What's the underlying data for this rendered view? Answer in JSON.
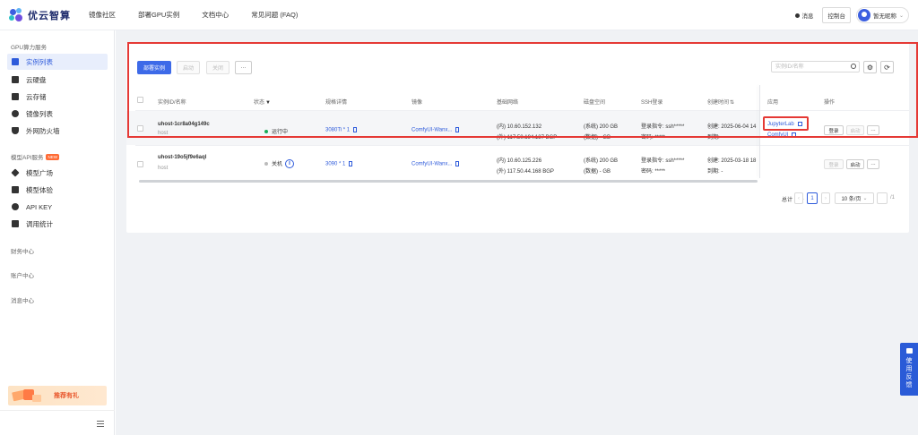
{
  "brand": {
    "name": "优云智算"
  },
  "topnav": [
    "镜像社区",
    "部署GPU实例",
    "文档中心",
    "常见问题 (FAQ)"
  ],
  "topright": {
    "message": "消息",
    "console": "控制台",
    "username": "暂无昵称"
  },
  "sidebar": {
    "section1": "GPU算力服务",
    "items1": [
      {
        "label": "实例列表",
        "icon": "server-list-icon",
        "active": true
      },
      {
        "label": "云硬盘",
        "icon": "disk-icon"
      },
      {
        "label": "云存储",
        "icon": "folder-icon"
      },
      {
        "label": "镜像列表",
        "icon": "image-icon"
      },
      {
        "label": "外网防火墙",
        "icon": "shield-icon"
      }
    ],
    "section2": "模型API服务",
    "section2_tag": "NEW",
    "items2": [
      {
        "label": "模型广场",
        "icon": "grid-icon"
      },
      {
        "label": "模型体验",
        "icon": "cube-icon"
      },
      {
        "label": "API KEY",
        "icon": "key-icon"
      },
      {
        "label": "调用统计",
        "icon": "chart-icon"
      }
    ],
    "section3": "财务中心",
    "section4": "账户中心",
    "section5": "消息中心",
    "promo": "推荐有礼"
  },
  "toolbar": {
    "deploy": "部署实例",
    "start": "启动",
    "shutdown": "关闭",
    "more": "···",
    "search_placeholder": "实例ID/名称"
  },
  "table": {
    "headers": [
      "实例ID/名称",
      "状态",
      "规格详情",
      "镜像",
      "基础网络",
      "磁盘空间",
      "SSH登录",
      "创建时间",
      "应用",
      "操作"
    ],
    "rows": [
      {
        "id": "uhost-1cr8a04g149c",
        "name": "host",
        "status": "运行中",
        "status_color": "#1aad5a",
        "spec": "3080Ti * 1",
        "image": "ComfyUI-Wanx...",
        "net_in": "(内) 10.60.152.132",
        "net_out": "(外) 117.50.194.137 BGP",
        "disk_sys": "(系统) 200 GB",
        "disk_data": "(数据) - GB",
        "ssh_cmd_label": "登录指令:",
        "ssh_cmd": "ssh*****",
        "ssh_pwd_label": "密码:",
        "ssh_pwd": "*****",
        "created": "创建: 2025-06-04 14",
        "expire": "到期: -",
        "apps": [
          "JupyterLab",
          "ComfyUI"
        ],
        "actions": [
          "登录",
          "启动",
          "···"
        ]
      },
      {
        "id": "uhost-19o5jf9e6aql",
        "name": "host",
        "status": "关机",
        "status_color": "#bbbbbb",
        "spec": "3090 * 1",
        "image": "ComfyUI-Wanx...",
        "net_in": "(内) 10.60.125.226",
        "net_out": "(外) 117.50.44.168 BGP",
        "disk_sys": "(系统) 200 GB",
        "disk_data": "(数据) - GB",
        "ssh_cmd_label": "登录指令:",
        "ssh_cmd": "ssh*****",
        "ssh_pwd_label": "密码:",
        "ssh_pwd": "*****",
        "created": "创建: 2025-03-18 18",
        "expire": "到期: -",
        "apps": [],
        "actions": [
          "登录",
          "启动",
          "···"
        ]
      }
    ]
  },
  "pagination": {
    "total": "总计 2 条",
    "page": "1",
    "page_size": "10 条/页",
    "of": "/1"
  },
  "feedback": [
    "使",
    "用",
    "反",
    "馈"
  ],
  "colors": {
    "primary": "#3d6ae8",
    "annotation": "#e53935",
    "running": "#1aad5a"
  }
}
